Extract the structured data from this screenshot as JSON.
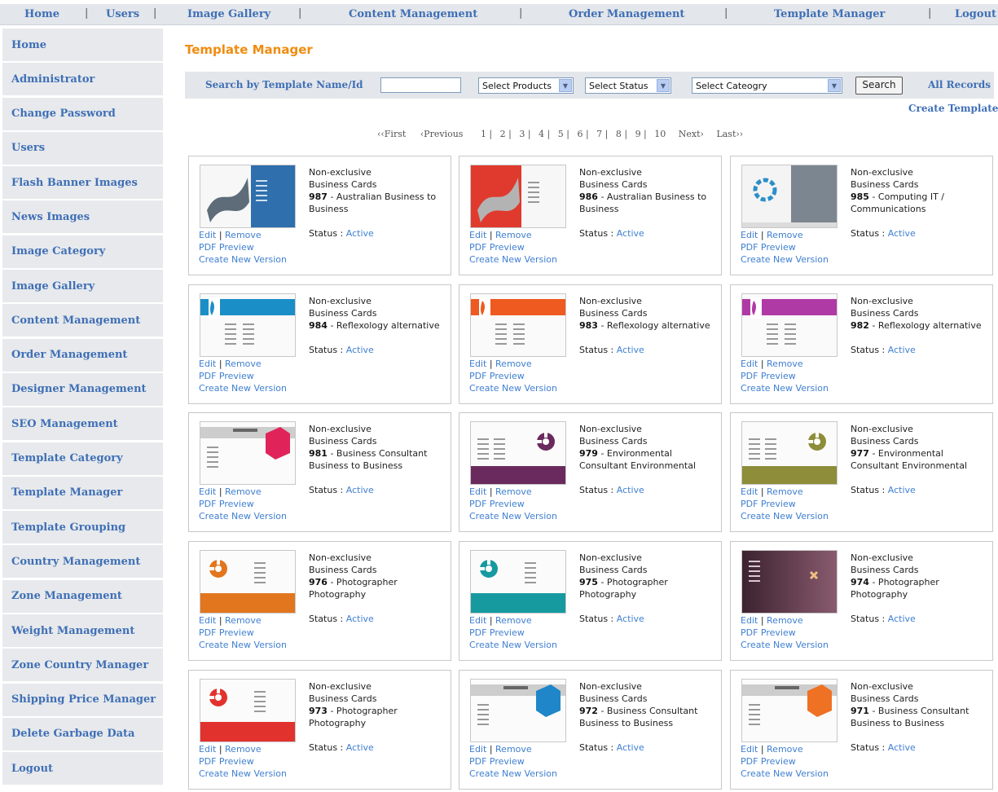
{
  "topnav": [
    {
      "label": "Home"
    },
    {
      "label": "Users"
    },
    {
      "label": "Image Gallery"
    },
    {
      "label": "Content Management"
    },
    {
      "label": "Order Management"
    },
    {
      "label": "Template Manager"
    },
    {
      "label": "Logout"
    }
  ],
  "sidebar": {
    "items": [
      {
        "label": "Home"
      },
      {
        "label": "Administrator"
      },
      {
        "label": "Change Password"
      },
      {
        "label": "Users"
      },
      {
        "label": "Flash Banner Images"
      },
      {
        "label": "News Images"
      },
      {
        "label": "Image Category"
      },
      {
        "label": "Image Gallery"
      },
      {
        "label": "Content Management"
      },
      {
        "label": "Order Management"
      },
      {
        "label": "Designer Management"
      },
      {
        "label": "SEO Management"
      },
      {
        "label": "Template Category"
      },
      {
        "label": "Template Manager"
      },
      {
        "label": "Template Grouping"
      },
      {
        "label": "Country Management"
      },
      {
        "label": "Zone Management"
      },
      {
        "label": "Weight Management"
      },
      {
        "label": "Zone Country Manager"
      },
      {
        "label": "Shipping Price Manager"
      },
      {
        "label": "Delete Garbage Data"
      },
      {
        "label": "Logout"
      }
    ]
  },
  "page_title": "Template Manager",
  "search": {
    "label": "Search by Template Name/Id",
    "input_value": "",
    "products_select": "Select Products",
    "status_select": "Select Status",
    "category_select": "Select Cateogry",
    "search_button": "Search",
    "all_records": "All Records"
  },
  "create_template": "Create Template",
  "pager": {
    "first": "‹‹First",
    "previous": "‹Previous",
    "pages": [
      "1 |",
      "2 |",
      "3 |",
      "4 |",
      "5 |",
      "6 |",
      "7 |",
      "8 |",
      "9 |",
      "10"
    ],
    "next": "Next›",
    "last": "Last››"
  },
  "card_labels": {
    "edit": "Edit",
    "sep": "|",
    "remove": "Remove",
    "pdf_preview": "PDF Preview",
    "create_version": "Create New Version",
    "status_label": "Status :"
  },
  "templates": [
    {
      "line1": "Non-exclusive",
      "line2": "Business Cards",
      "id": "987",
      "desc": "- Australian Business to Business",
      "status": "Active",
      "thumb": "wave-blue"
    },
    {
      "line1": "Non-exclusive",
      "line2": "Business Cards",
      "id": "986",
      "desc": "- Australian Business to Business",
      "status": "Active",
      "thumb": "wave-red"
    },
    {
      "line1": "Non-exclusive",
      "line2": "Business Cards",
      "id": "985",
      "desc": "- Computing IT / Communications",
      "status": "Active",
      "thumb": "circle-gray"
    },
    {
      "line1": "Non-exclusive",
      "line2": "Business Cards",
      "id": "984",
      "desc": "- Reflexology alternative",
      "status": "Active",
      "thumb": "foot-cyan"
    },
    {
      "line1": "Non-exclusive",
      "line2": "Business Cards",
      "id": "983",
      "desc": "- Reflexology alternative",
      "status": "Active",
      "thumb": "foot-orange"
    },
    {
      "line1": "Non-exclusive",
      "line2": "Business Cards",
      "id": "982",
      "desc": "- Reflexology alternative",
      "status": "Active",
      "thumb": "foot-magenta"
    },
    {
      "line1": "Non-exclusive",
      "line2": "Business Cards",
      "id": "981",
      "desc": "- Business Consultant Business to Business",
      "status": "Active",
      "thumb": "cube-pink"
    },
    {
      "line1": "Non-exclusive",
      "line2": "Business Cards",
      "id": "979",
      "desc": "- Environmental Consultant Environmental",
      "status": "Active",
      "thumb": "star-purple"
    },
    {
      "line1": "Non-exclusive",
      "line2": "Business Cards",
      "id": "977",
      "desc": "- Environmental Consultant Environmental",
      "status": "Active",
      "thumb": "star-olive"
    },
    {
      "line1": "Non-exclusive",
      "line2": "Business Cards",
      "id": "976",
      "desc": "- Photographer Photography",
      "status": "Active",
      "thumb": "flower-orange"
    },
    {
      "line1": "Non-exclusive",
      "line2": "Business Cards",
      "id": "975",
      "desc": "- Photographer Photography",
      "status": "Active",
      "thumb": "flower-teal"
    },
    {
      "line1": "Non-exclusive",
      "line2": "Business Cards",
      "id": "974",
      "desc": "- Photographer Photography",
      "status": "Active",
      "thumb": "dark-plum"
    },
    {
      "line1": "Non-exclusive",
      "line2": "Business Cards",
      "id": "973",
      "desc": "- Photographer Photography",
      "status": "Active",
      "thumb": "flower-red"
    },
    {
      "line1": "Non-exclusive",
      "line2": "Business Cards",
      "id": "972",
      "desc": "- Business Consultant Business to Business",
      "status": "Active",
      "thumb": "cube-blue"
    },
    {
      "line1": "Non-exclusive",
      "line2": "Business Cards",
      "id": "971",
      "desc": "- Business Consultant Business to Business",
      "status": "Active",
      "thumb": "cube-orange"
    }
  ],
  "colors": {
    "link": "#3f6fb6",
    "title": "#f08c10",
    "nav_bg": "#e3e6ea"
  }
}
